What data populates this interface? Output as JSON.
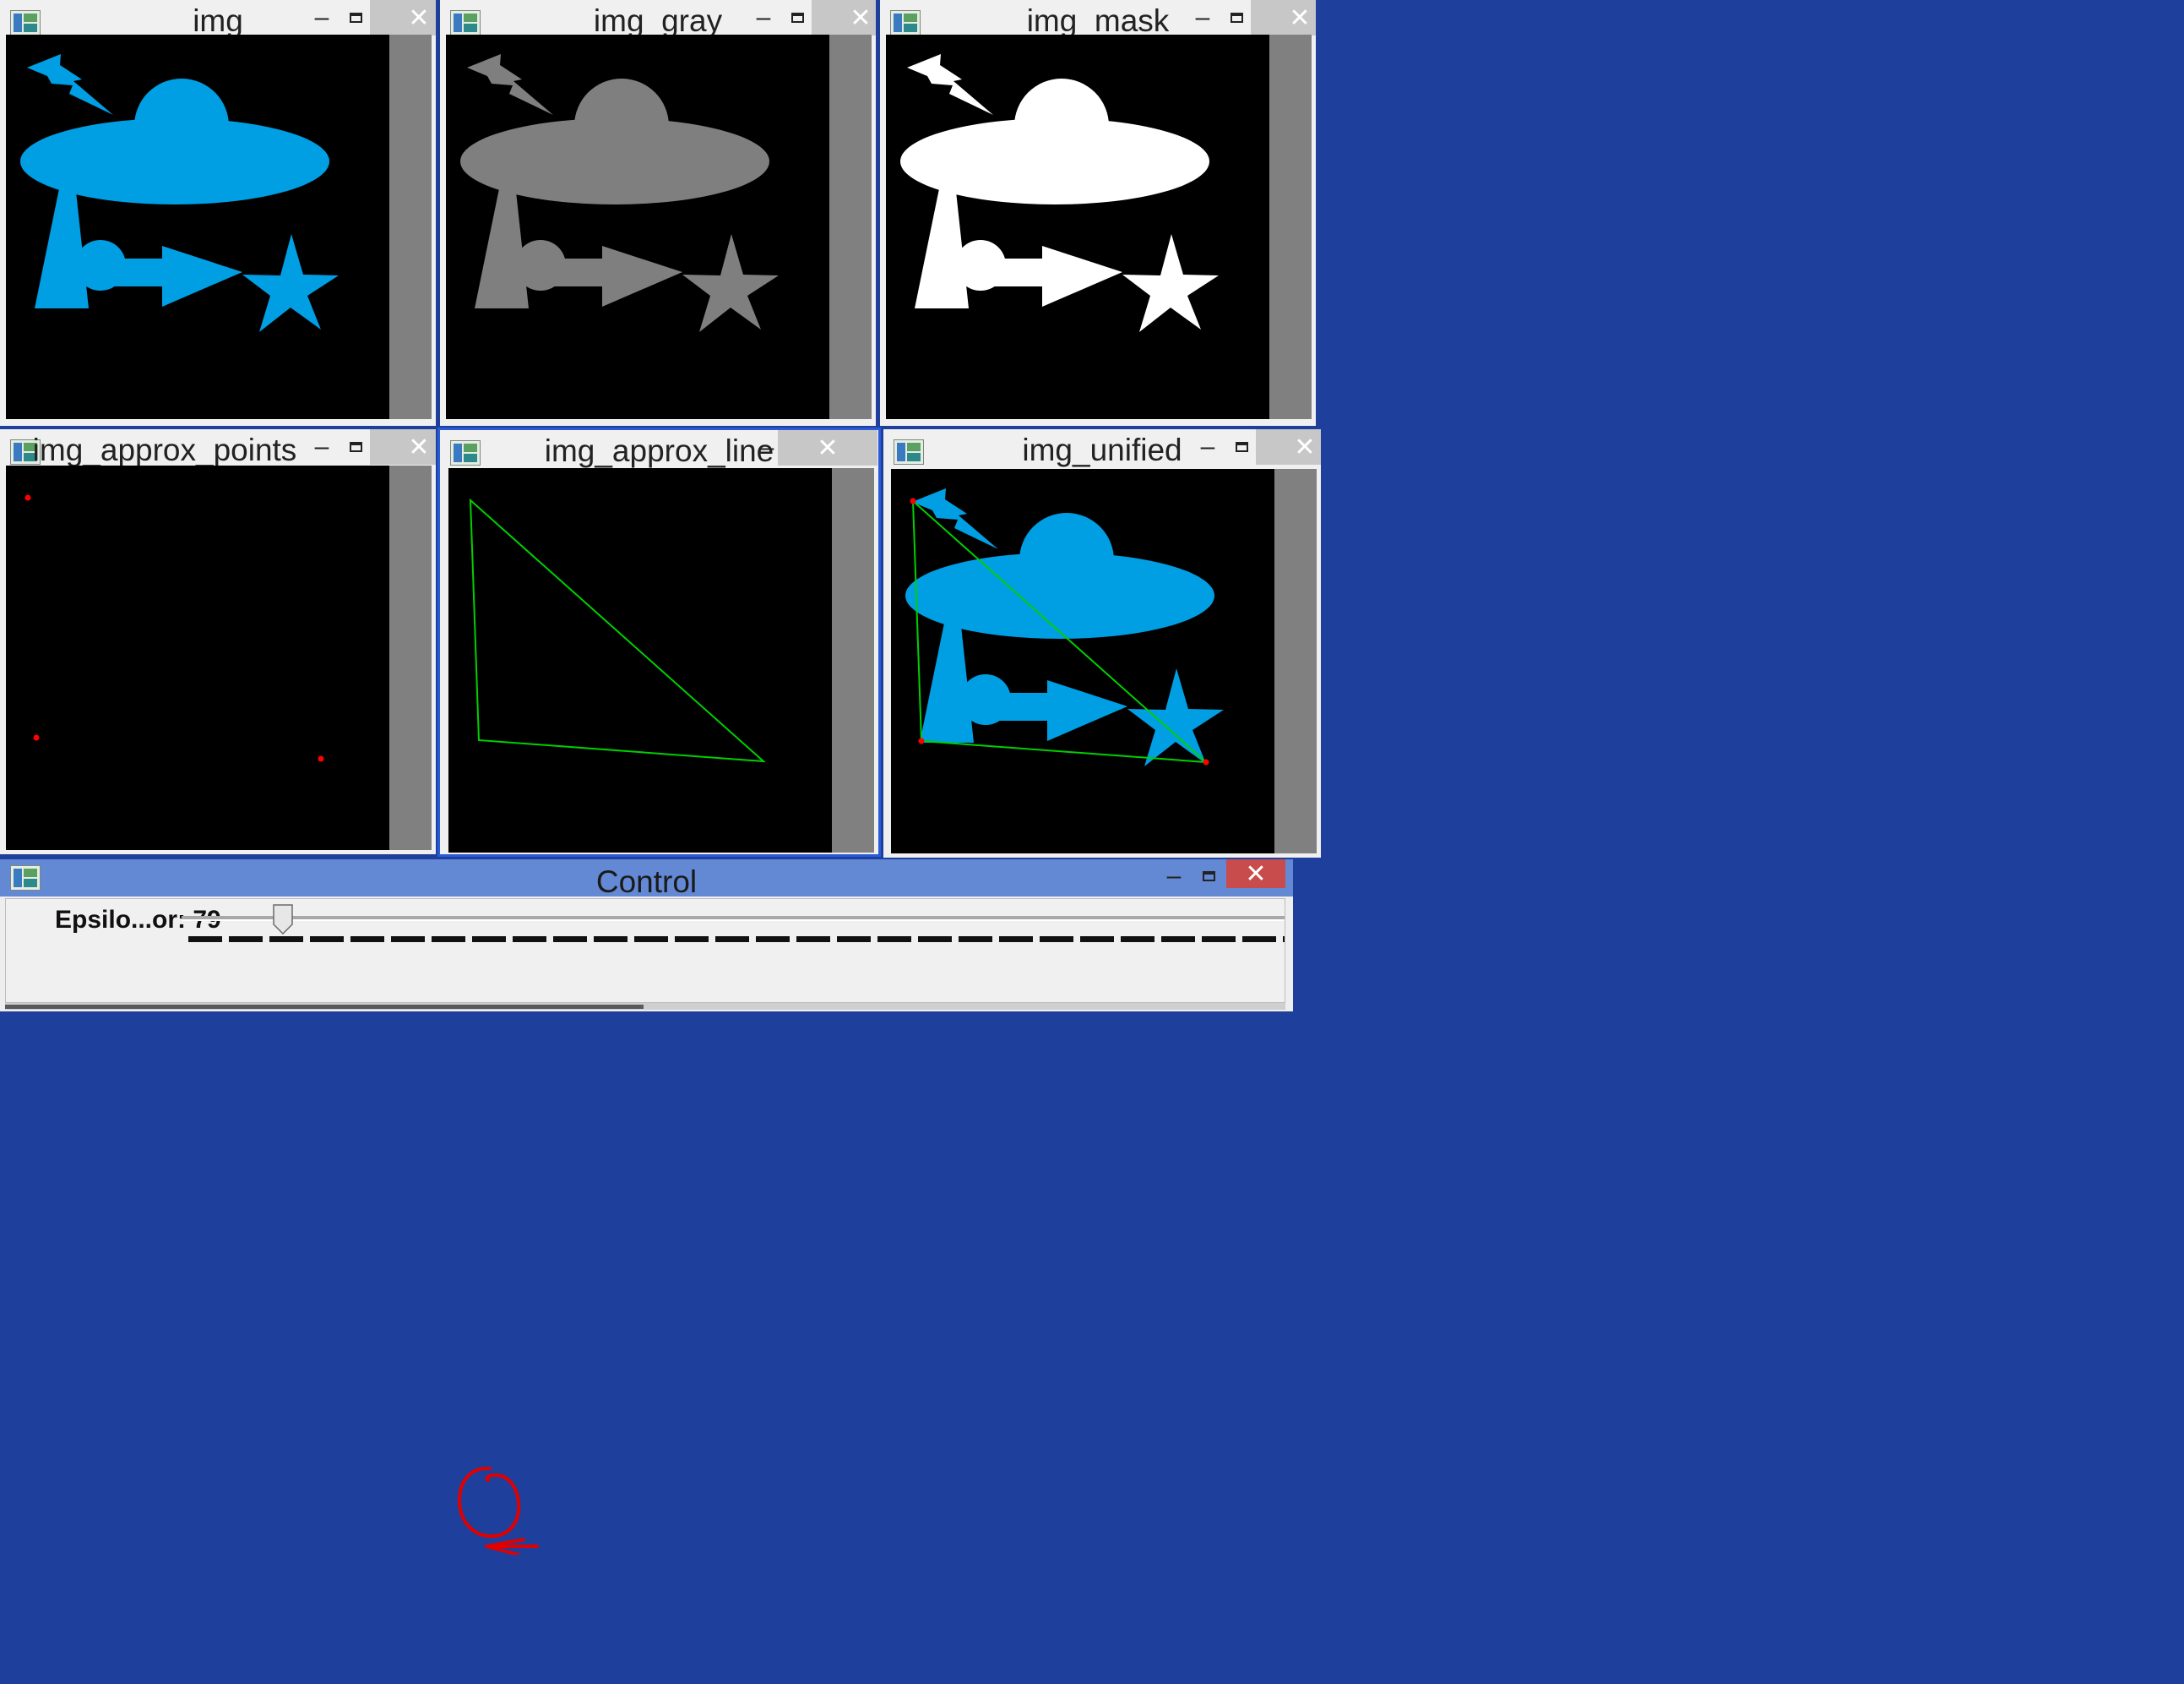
{
  "windows": {
    "img": {
      "title": "img"
    },
    "img_gray": {
      "title": "img_gray"
    },
    "img_mask": {
      "title": "img_mask"
    },
    "img_approx_points": {
      "title": "img_approx_points"
    },
    "img_approx_line": {
      "title": "img_approx_line"
    },
    "img_unified": {
      "title": "img_unified"
    }
  },
  "control": {
    "title": "Control",
    "trackbar": {
      "label": "Epsilo...or: 79",
      "value": 79
    }
  },
  "titlebar_buttons": {
    "minimize": "–",
    "close": "✕"
  },
  "colors": {
    "shape_blue": "#009fe3",
    "shape_gray": "#7f7f7f",
    "shape_white": "#ffffff",
    "approx_line": "#00d000",
    "approx_point": "#ff0000",
    "annotation": "#e00000",
    "desktop": "#1e3f9c"
  },
  "icons": {
    "app": "opencv-window-icon",
    "annotation": "hand-drawn-circle-arrow"
  }
}
